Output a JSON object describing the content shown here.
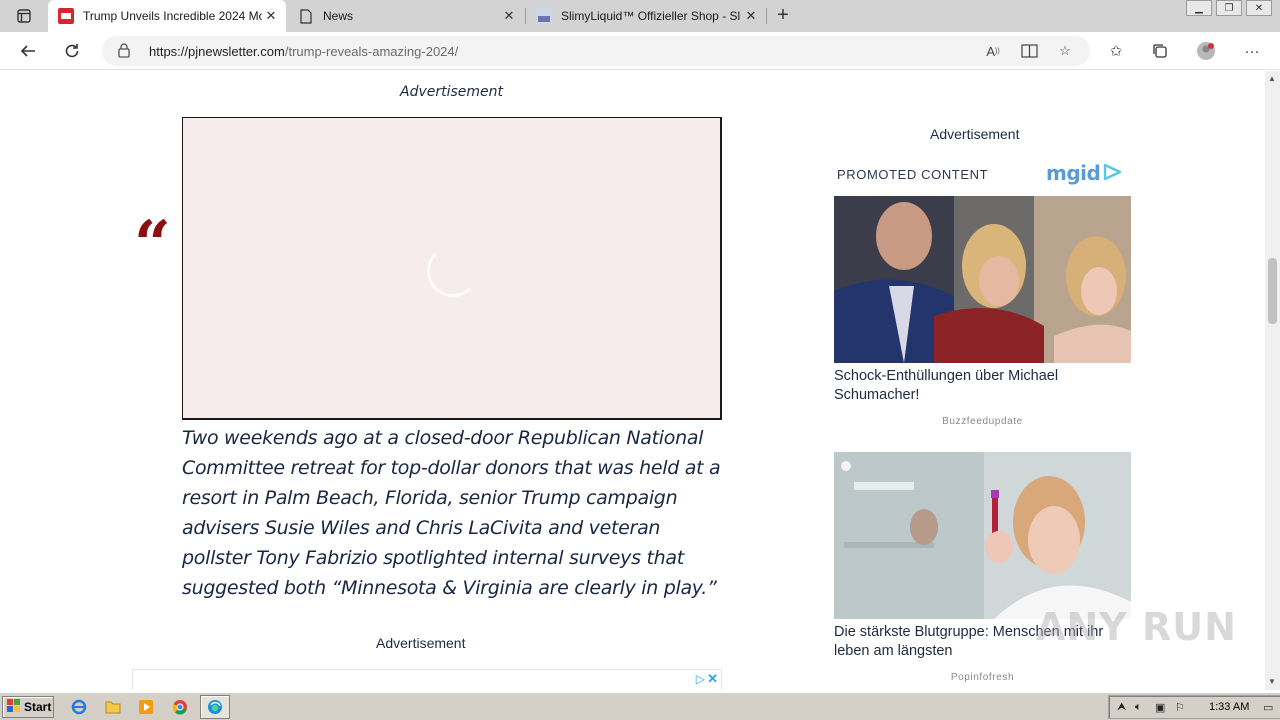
{
  "browser": {
    "tabs": [
      {
        "title": "Trump Unveils Incredible 2024 Mo",
        "active": true,
        "icon": "pjnewsletter-favicon"
      },
      {
        "title": "News",
        "active": false,
        "icon": "page-icon"
      },
      {
        "title": "SlimyLiquid™ Offizieller Shop - Sl",
        "active": false,
        "icon": "slimy-favicon"
      }
    ],
    "url_domain": "https://pjnewsletter.com",
    "url_path": "/trump-reveals-amazing-2024/"
  },
  "article": {
    "ad_label_top": "Advertisement",
    "quote_mark": "“",
    "quote_text": "Two weekends ago at a closed-door Republican National Committee retreat for top-dollar donors that was held at a resort in Palm Beach, Florida, senior Trump campaign advisers Susie Wiles and Chris LaCivita and veteran pollster Tony Fabrizio spotlighted internal surveys that suggested both “Minnesota & Virginia are clearly in play.”",
    "ad_label_bottom": "Advertisement"
  },
  "sidebar": {
    "ad_label": "Advertisement",
    "promoted_label": "PROMOTED CONTENT",
    "brand": "mgid",
    "cards": [
      {
        "title": "Schock-Enthüllungen über Michael Schumacher!",
        "source": "Buzzfeedupdate"
      },
      {
        "title": "Die stärkste Blutgruppe: Menschen mit ihr leben am längsten",
        "source": "Popinfofresh"
      }
    ]
  },
  "watermark": "ANY RUN",
  "taskbar": {
    "start_label": "Start",
    "clock": "1:33 AM"
  },
  "colors": {
    "quote_mark": "#8b0f0f",
    "text": "#1a2744",
    "ad_bg": "#f6ecec",
    "mgid": "#5b9bd5"
  }
}
